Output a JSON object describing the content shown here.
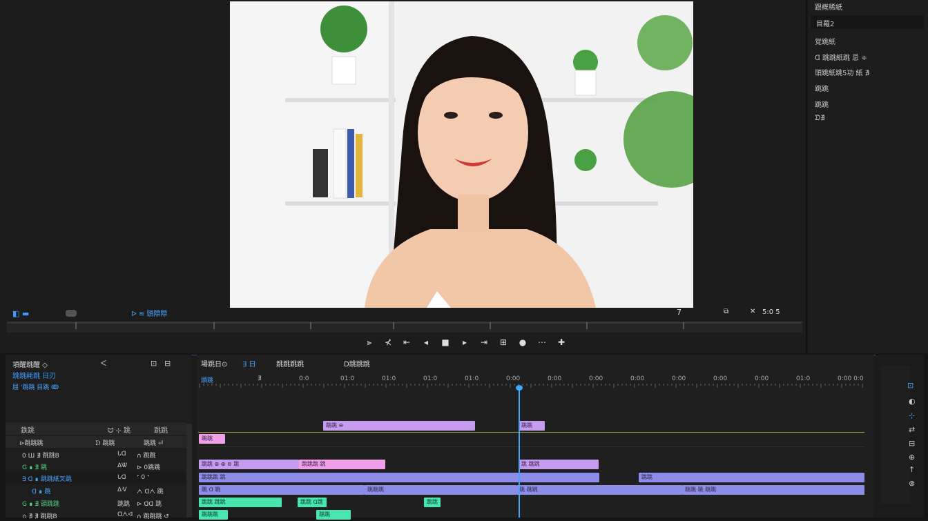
{
  "source_panel": {
    "status_left": "◧ ▬",
    "toggle_label": "ᐅ ≋ 頭際際",
    "timecode": "5:0 5",
    "frame_marker": "7",
    "transport_icons": [
      "mark-in-icon",
      "mark-out-icon",
      "go-in-icon",
      "step-back-icon",
      "play-stop-icon",
      "step-forward-icon",
      "go-out-icon",
      "insert-icon",
      "overwrite-icon",
      "export-frame-icon",
      "more-icon"
    ]
  },
  "right_panel": {
    "header": "跟概稀紙",
    "items": [
      "目羅2",
      "覚跳紙",
      "ᗡ 跳跳紙跳   忌 ≑",
      "頭跳紙跳5功   紙 ∄",
      "跳跳",
      "跳跳",
      "ᗤ∄"
    ]
  },
  "left_bin": {
    "title": "項醒跳醒 ◇",
    "subtitle": "跳跳耗跳 日刃",
    "tab": "屈 '跳跳   目跳 ↂ",
    "columns": [
      "鉄跳",
      "ᗢ ⊹ 跳",
      "跳跳"
    ],
    "rows": [
      {
        "col1": "⊳跳跳跳",
        "col2": "ᗤ 跳跳",
        "col3": "跳跳 ⏎"
      },
      {
        "col1": "0 Ш ∄ 跳跳B",
        "col2": "ᒐᗡ",
        "col3": "∩ 跳跳"
      },
      {
        "col1": "G ∎ ∄ 跳",
        "col2": "ᐃᏔ",
        "col3": "⊳ 0跳跳"
      },
      {
        "col1": "∃ ᗡ ∎ 跳跳紙叉跳",
        "col2": "ᒐᗡ",
        "col3": "ᐩ 0 ᐩ"
      },
      {
        "col1": "ᗡ ∎ 跳",
        "col2": "ᐃᐺ",
        "col3": "ᗅ ᗡᗅ 跳"
      },
      {
        "col1": "G ∎ ∄ 頭跳跳",
        "col2": "跳跳",
        "col3": "⊳ ᗡᗡ 跳"
      },
      {
        "col1": "∩ ∄ ∄ 跳跳B",
        "col2": "ᗡᗅᐊ",
        "col3": "∩ 跳跳跳 ↺"
      }
    ]
  },
  "timeline": {
    "tabs": [
      "場跳日⊙",
      "∃ 日",
      "跳跳跳跳",
      "ᗞ跳跳跳"
    ],
    "ruler_label": "頭跳",
    "ticks": [
      "∄",
      "0:0",
      "01:0",
      "01:0",
      "01:0",
      "01:0",
      "0:00",
      "0:00",
      "0:00",
      "0:00",
      "0:00",
      "0:00",
      "0:00",
      "01:0",
      "0:00 0:0"
    ],
    "clips": [
      {
        "label": "跳跳 ⊖",
        "cls": "vio"
      },
      {
        "label": "跳跳",
        "cls": "vio"
      },
      {
        "label": "跳跳",
        "cls": "pnk"
      },
      {
        "label": "跳跳 ⊕ ⊕ ⊜ 跳",
        "cls": "vio"
      },
      {
        "label": "跳跳跳 跳",
        "cls": "pnk"
      },
      {
        "label": "跳 跳跳",
        "cls": "vio"
      },
      {
        "label": "跳跳跳 跳",
        "cls": "blu"
      },
      {
        "label": "跳跳",
        "cls": "blu"
      },
      {
        "label": "跳 ᗡ 跳",
        "cls": "blu"
      },
      {
        "label": "跳跳跳",
        "cls": "blu"
      },
      {
        "label": "跳 跳跳",
        "cls": "blu"
      },
      {
        "label": "跳跳 跳 跳跳",
        "cls": "blu"
      },
      {
        "label": "跳跳 跳跳",
        "cls": "grn"
      },
      {
        "label": "跳跳 ᗡ跳",
        "cls": "grn"
      },
      {
        "label": "跳跳",
        "cls": "grn"
      },
      {
        "label": "跳跳跳",
        "cls": "grn"
      },
      {
        "label": "跳跳",
        "cls": "grn"
      }
    ]
  },
  "tools": [
    "selection-icon",
    "track-select-icon",
    "ripple-icon",
    "razor-icon",
    "slip-icon",
    "pen-icon",
    "hand-icon",
    "type-icon"
  ]
}
